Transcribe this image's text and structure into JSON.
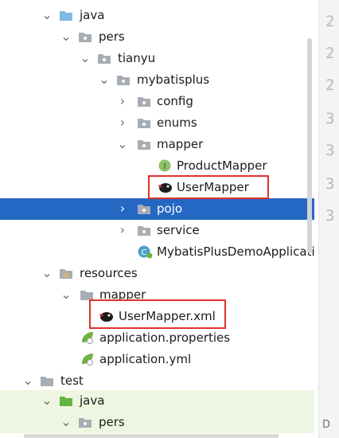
{
  "tree": {
    "nodes": [
      {
        "label": "java",
        "icon": "folder-blue",
        "expanded": true
      },
      {
        "label": "pers",
        "icon": "folder",
        "expanded": true
      },
      {
        "label": "tianyu",
        "icon": "folder",
        "expanded": true
      },
      {
        "label": "mybatisplus",
        "icon": "folder",
        "expanded": true
      },
      {
        "label": "config",
        "icon": "folder",
        "expanded": false
      },
      {
        "label": "enums",
        "icon": "folder",
        "expanded": false
      },
      {
        "label": "mapper",
        "icon": "folder",
        "expanded": true
      },
      {
        "label": "ProductMapper",
        "icon": "interface",
        "badge": "I"
      },
      {
        "label": "UserMapper",
        "icon": "mybatis-bird",
        "highlighted": true
      },
      {
        "label": "pojo",
        "icon": "folder",
        "expanded": false,
        "selected": true
      },
      {
        "label": "service",
        "icon": "folder",
        "expanded": false
      },
      {
        "label": "MybatisPlusDemoApplicatio",
        "icon": "spring-boot-class"
      },
      {
        "label": "resources",
        "icon": "folder-resources",
        "expanded": true
      },
      {
        "label": "mapper",
        "icon": "folder",
        "expanded": true
      },
      {
        "label": "UserMapper.xml",
        "icon": "mybatis-bird",
        "highlighted": true
      },
      {
        "label": "application.properties",
        "icon": "spring-config"
      },
      {
        "label": "application.yml",
        "icon": "spring-config"
      },
      {
        "label": "test",
        "icon": "folder",
        "expanded": true
      },
      {
        "label": "java",
        "icon": "folder-test",
        "expanded": true
      },
      {
        "label": "pers",
        "icon": "folder",
        "expanded": true
      }
    ]
  },
  "gutter": {
    "line_numbers": [
      "2",
      "2",
      "2",
      "3",
      "3",
      "3",
      "3"
    ],
    "footer": "D"
  },
  "colors": {
    "selection": "#2468c4",
    "highlight_box": "#e0312a",
    "test_row_bg": "#eef6e2",
    "folder_gray": "#a7adb4",
    "folder_blue": "#7db9e3",
    "folder_green": "#62b543"
  }
}
